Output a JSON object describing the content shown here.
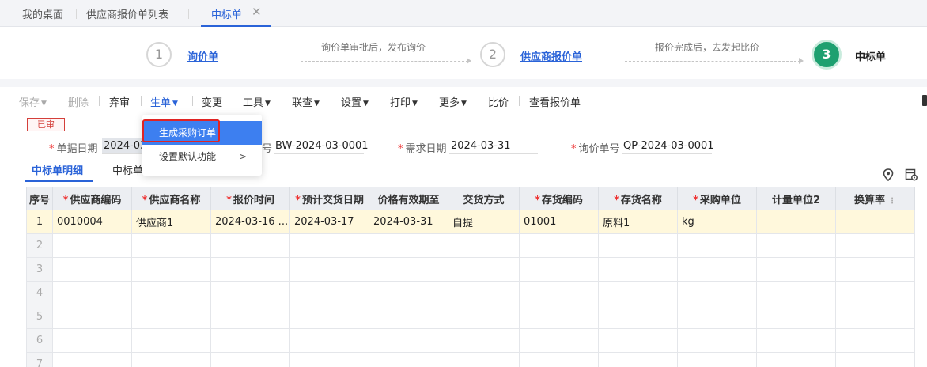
{
  "tabs": [
    {
      "label": "我的桌面"
    },
    {
      "label": "供应商报价单列表"
    },
    {
      "label": "中标单",
      "active": true
    }
  ],
  "steps": [
    {
      "num": "1",
      "label": "询价单"
    },
    {
      "note": "询价单审批后，发布询价"
    },
    {
      "num": "2",
      "label": "供应商报价单"
    },
    {
      "note": "报价完成后，去发起比价"
    },
    {
      "num": "3",
      "label": "中标单"
    }
  ],
  "toolbar": {
    "save": "保存",
    "delete": "删除",
    "abandon_review": "弃审",
    "generate": "生单",
    "change": "变更",
    "tools": "工具",
    "query": "联查",
    "settings": "设置",
    "print": "打印",
    "more": "更多",
    "compare": "比价",
    "view_quotes": "查看报价单"
  },
  "dropdown": {
    "items": [
      {
        "label": "生成采购订单",
        "highlighted": true
      },
      {
        "label": "设置默认功能",
        "has_submenu": true
      }
    ]
  },
  "status": "已审",
  "form": {
    "doc_date_label": "单据日期",
    "doc_date_value": "2024-03",
    "doc_no_label": "号",
    "doc_no_value": "BW-2024-03-0001",
    "demand_date_label": "需求日期",
    "demand_date_value": "2024-03-31",
    "inquiry_no_label": "询价单号",
    "inquiry_no_value": "QP-2024-03-0001"
  },
  "subtabs": [
    {
      "label": "中标单明细",
      "active": true
    },
    {
      "label": "中标单"
    }
  ],
  "table": {
    "columns": [
      {
        "label": "序号"
      },
      {
        "label": "供应商编码",
        "required": true
      },
      {
        "label": "供应商名称",
        "required": true
      },
      {
        "label": "报价时间",
        "required": true
      },
      {
        "label": "预计交货日期",
        "required": true
      },
      {
        "label": "价格有效期至"
      },
      {
        "label": "交货方式"
      },
      {
        "label": "存货编码",
        "required": true
      },
      {
        "label": "存货名称",
        "required": true
      },
      {
        "label": "采购单位",
        "required": true
      },
      {
        "label": "计量单位2"
      },
      {
        "label": "换算率"
      }
    ],
    "rows": [
      [
        "1",
        "0010004",
        "供应商1",
        "2024-03-16 ...",
        "2024-03-17",
        "2024-03-31",
        "自提",
        "01001",
        "原料1",
        "kg",
        "",
        ""
      ],
      [
        "2",
        "",
        "",
        "",
        "",
        "",
        "",
        "",
        "",
        "",
        "",
        ""
      ],
      [
        "3",
        "",
        "",
        "",
        "",
        "",
        "",
        "",
        "",
        "",
        "",
        ""
      ],
      [
        "4",
        "",
        "",
        "",
        "",
        "",
        "",
        "",
        "",
        "",
        "",
        ""
      ],
      [
        "5",
        "",
        "",
        "",
        "",
        "",
        "",
        "",
        "",
        "",
        "",
        ""
      ],
      [
        "6",
        "",
        "",
        "",
        "",
        "",
        "",
        "",
        "",
        "",
        "",
        ""
      ],
      [
        "7",
        "",
        "",
        "",
        "",
        "",
        "",
        "",
        "",
        "",
        "",
        ""
      ]
    ]
  },
  "colors": {
    "accent": "#2a63d8",
    "step_done": "#1ea070",
    "row_highlight": "#fff8dc",
    "menu_highlight": "#3d7ff0",
    "status_red": "#d43f3a"
  }
}
